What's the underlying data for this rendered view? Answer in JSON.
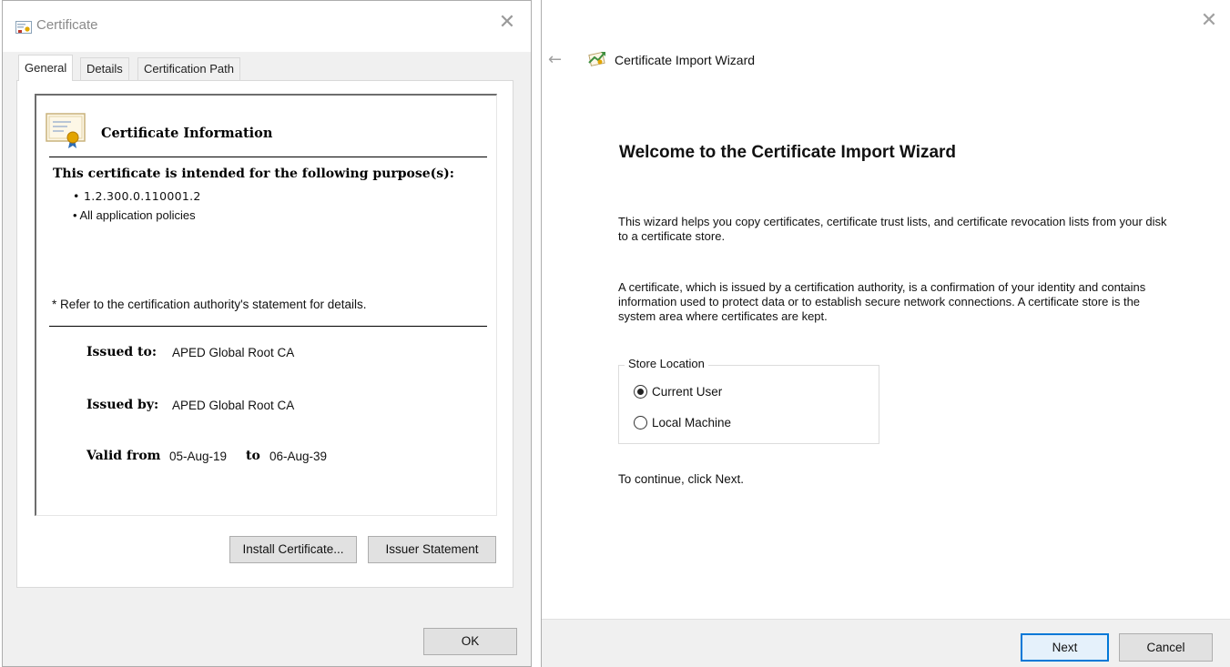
{
  "certificate_dialog": {
    "title": "Certificate",
    "close_glyph": "✕",
    "tabs": [
      {
        "label": "General",
        "selected": true
      },
      {
        "label": "Details",
        "selected": false
      },
      {
        "label": "Certification Path",
        "selected": false
      }
    ],
    "info_heading": "Certificate Information",
    "purpose_heading": "This certificate is intended for the following purpose(s):",
    "purposes": [
      "• 1.2.300.0.110001.2",
      "• All application policies"
    ],
    "refer_note": "* Refer to the certification authority's statement for details.",
    "issued_to_label": "Issued to:",
    "issued_to_value": "APED Global Root CA",
    "issued_by_label": "Issued by:",
    "issued_by_value": "APED Global Root CA",
    "valid_from_label": "Valid from",
    "valid_from_value": "05-Aug-19",
    "valid_to_label": "to",
    "valid_to_value": "06-Aug-39",
    "install_button": "Install Certificate...",
    "issuer_statement_button": "Issuer Statement",
    "ok_button": "OK"
  },
  "wizard": {
    "close_glyph": "✕",
    "back_glyph": "←",
    "title": "Certificate Import Wizard",
    "heading": "Welcome to the Certificate Import Wizard",
    "paragraph_1": "This wizard helps you copy certificates, certificate trust lists, and certificate revocation lists from your disk to a certificate store.",
    "paragraph_2": "A certificate, which is issued by a certification authority, is a confirmation of your identity and contains information used to protect data or to establish secure network connections. A certificate store is the system area where certificates are kept.",
    "store_location_legend": "Store Location",
    "store_options": [
      {
        "label": "Current User",
        "selected": true
      },
      {
        "label": "Local Machine",
        "selected": false
      }
    ],
    "continue_note": "To continue, click Next.",
    "next_button": "Next",
    "cancel_button": "Cancel"
  },
  "colors": {
    "dialog_background": "#f0f0f0",
    "button_background": "#e1e1e1",
    "accent_border": "#0078d7"
  }
}
